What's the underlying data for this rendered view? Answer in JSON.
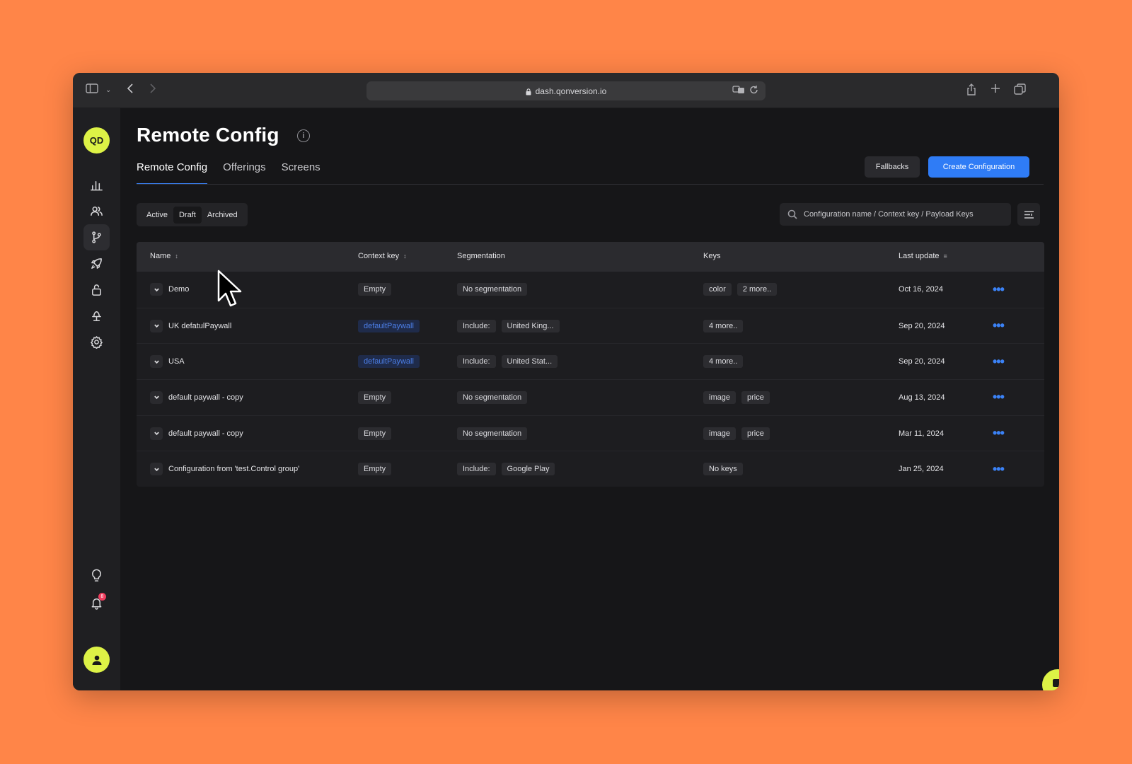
{
  "browser": {
    "url": "dash.qonversion.io"
  },
  "sidebar": {
    "workspace_initials": "QD",
    "items": [
      {
        "name": "analytics"
      },
      {
        "name": "customers"
      },
      {
        "name": "experiments"
      },
      {
        "name": "launch"
      },
      {
        "name": "entitlements"
      },
      {
        "name": "integrations"
      },
      {
        "name": "settings"
      }
    ],
    "notifications_count": "8"
  },
  "header": {
    "title": "Remote Config",
    "tabs": [
      {
        "label": "Remote Config",
        "active": true
      },
      {
        "label": "Offerings",
        "active": false
      },
      {
        "label": "Screens",
        "active": false
      }
    ],
    "fallbacks_label": "Fallbacks",
    "create_label": "Create Configuration"
  },
  "filters": [
    {
      "label": "Active",
      "active": false
    },
    {
      "label": "Draft",
      "active": true
    },
    {
      "label": "Archived",
      "active": false
    }
  ],
  "search": {
    "placeholder": "Configuration name / Context key / Payload Keys"
  },
  "table": {
    "columns": {
      "name": "Name",
      "context_key": "Context key",
      "segmentation": "Segmentation",
      "keys": "Keys",
      "last_update": "Last update"
    },
    "rows": [
      {
        "name": "Demo",
        "context_key": "Empty",
        "context_blue": false,
        "seg": [
          "No segmentation"
        ],
        "keys": [
          "color",
          "2 more.."
        ],
        "last_update": "Oct 16, 2024"
      },
      {
        "name": "UK defatulPaywall",
        "context_key": "defaultPaywall",
        "context_blue": true,
        "seg": [
          "Include:",
          "United King..."
        ],
        "keys": [
          "4 more.."
        ],
        "last_update": "Sep 20, 2024"
      },
      {
        "name": "USA",
        "context_key": "defaultPaywall",
        "context_blue": true,
        "seg": [
          "Include:",
          "United Stat..."
        ],
        "keys": [
          "4 more.."
        ],
        "last_update": "Sep 20, 2024"
      },
      {
        "name": "default paywall - copy",
        "context_key": "Empty",
        "context_blue": false,
        "seg": [
          "No segmentation"
        ],
        "keys": [
          "image",
          "price"
        ],
        "last_update": "Aug 13, 2024"
      },
      {
        "name": "default paywall - copy",
        "context_key": "Empty",
        "context_blue": false,
        "seg": [
          "No segmentation"
        ],
        "keys": [
          "image",
          "price"
        ],
        "last_update": "Mar 11, 2024"
      },
      {
        "name": "Configuration from 'test.Control group'",
        "context_key": "Empty",
        "context_blue": false,
        "seg": [
          "Include:",
          "Google Play"
        ],
        "keys": [
          "No keys"
        ],
        "last_update": "Jan 25, 2024"
      }
    ]
  },
  "colors": {
    "accent": "#2f7cf6",
    "brand": "#ddf246",
    "background": "#ff8548"
  }
}
